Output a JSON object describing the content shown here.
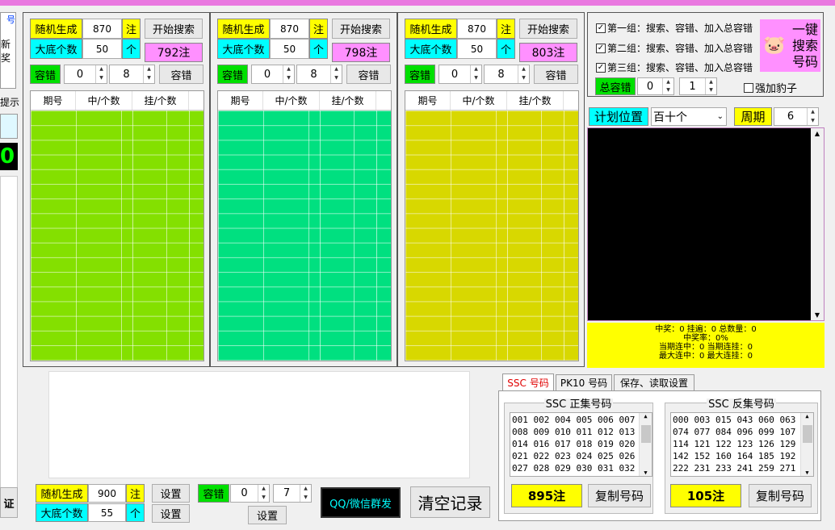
{
  "left": {
    "frag1": "号",
    "frag2": "新",
    "frag3": "奖",
    "hint": "提示",
    "zero": "0",
    "zheng": "证"
  },
  "groups": [
    {
      "gen": "随机生成",
      "gen_val": "870",
      "zhu": "注",
      "start": "开始搜索",
      "base": "大底个数",
      "base_val": "50",
      "ge": "个",
      "count": "792注",
      "rong": "容错",
      "r1": "0",
      "r2": "8",
      "rbtn": "容错",
      "color": "#84e000",
      "cols": [
        "期号",
        "中/个数",
        "挂/个数"
      ]
    },
    {
      "gen": "随机生成",
      "gen_val": "870",
      "zhu": "注",
      "start": "开始搜索",
      "base": "大底个数",
      "base_val": "50",
      "ge": "个",
      "count": "798注",
      "rong": "容错",
      "r1": "0",
      "r2": "8",
      "rbtn": "容错",
      "color": "#00e080",
      "cols": [
        "期号",
        "中/个数",
        "挂/个数"
      ]
    },
    {
      "gen": "随机生成",
      "gen_val": "870",
      "zhu": "注",
      "start": "开始搜索",
      "base": "大底个数",
      "base_val": "50",
      "ge": "个",
      "count": "803注",
      "rong": "容错",
      "r1": "0",
      "r2": "8",
      "rbtn": "容错",
      "color": "#d8d800",
      "cols": [
        "期号",
        "中/个数",
        "挂/个数"
      ]
    }
  ],
  "right": {
    "checks": [
      "第一组：搜索、容错、加入总容错",
      "第二组：搜索、容错、加入总容错",
      "第三组：搜索、容错、加入总容错"
    ],
    "onekey": [
      "一键",
      "搜索",
      "号码"
    ],
    "total": "总容错",
    "t1": "0",
    "t2": "1",
    "leopard": "强加豹子",
    "plan": "计划位置",
    "plan_sel": "百十个",
    "period": "周期",
    "period_val": "6",
    "stats1": "中奖：0  挂遍：0  总数量：0",
    "stats2": "中奖率：0%",
    "stats3": "当期连中：0  当期连挂：0",
    "stats4": "最大连中：0  最大连挂：0"
  },
  "tabs": [
    "SSC 号码",
    "PK10 号码",
    "保存、读取设置"
  ],
  "ssc": {
    "pos_title": "SSC 正集号码",
    "neg_title": "SSC 反集号码",
    "pos_rows": [
      "001 002 004 005 006 007",
      "008 009 010 011 012 013",
      "014 016 017 018 019 020",
      "021 022 023 024 025 026",
      "027 028 029 030 031 032"
    ],
    "neg_rows": [
      "000 003 015 043 060 063",
      "074 077 084 096 099 107",
      "114 121 122 123 126 129",
      "142 152 160 164 185 192",
      "222 231 233 241 259 271"
    ],
    "pos_count": "895注",
    "neg_count": "105注",
    "copy": "复制号码"
  },
  "bottom": {
    "gen": "随机生成",
    "gen_val": "900",
    "zhu": "注",
    "set": "设置",
    "base": "大底个数",
    "base_val": "55",
    "ge": "个",
    "rong": "容错",
    "r1": "0",
    "r2": "7",
    "qq": "QQ/微信群发",
    "clear": "清空记录"
  }
}
